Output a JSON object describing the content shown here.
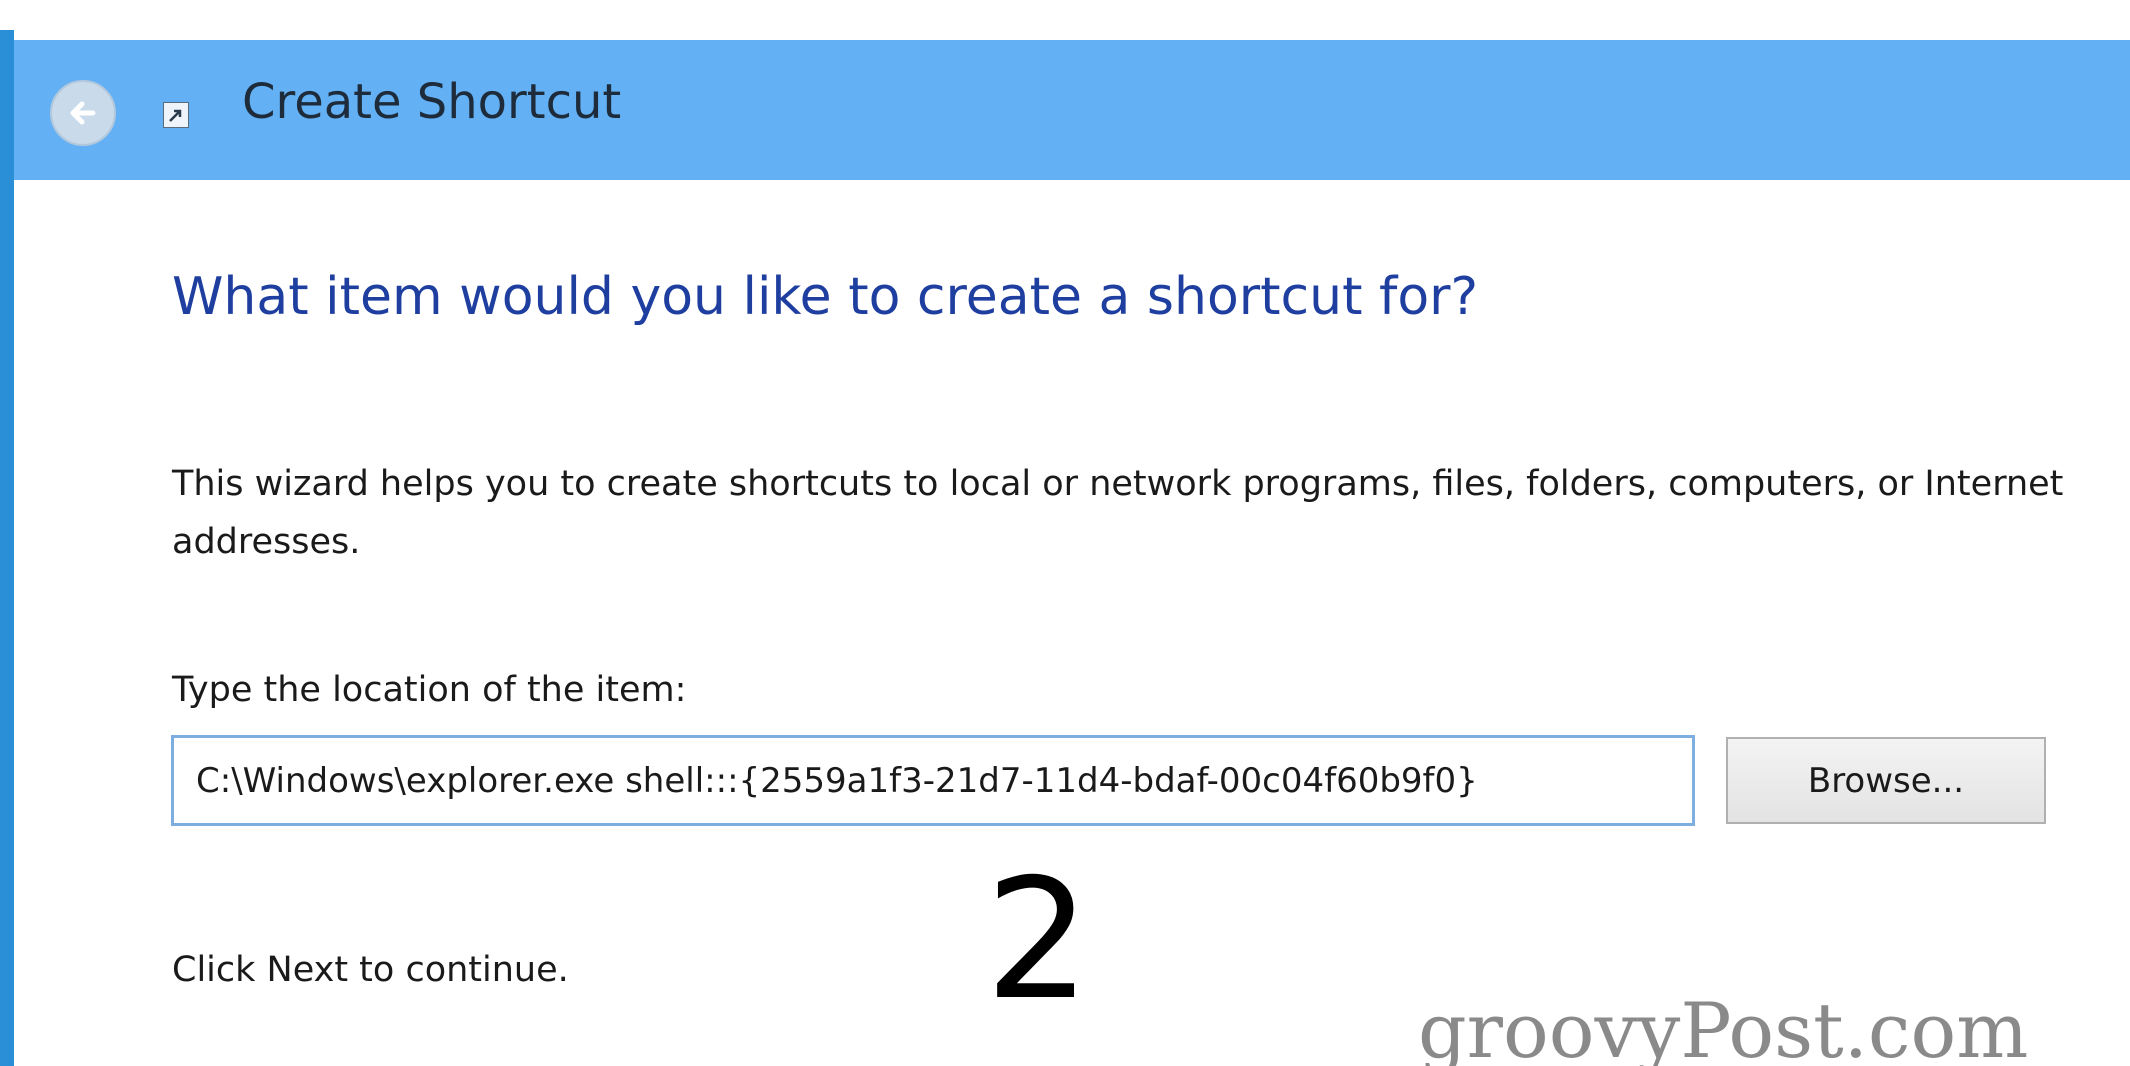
{
  "window": {
    "title": "Create Shortcut"
  },
  "wizard": {
    "heading": "What item would you like to create a shortcut for?",
    "description": "This wizard helps you to create shortcuts to local or network programs, files, folders, computers, or Internet addresses.",
    "location_label": "Type the location of the item:",
    "location_value": "C:\\Windows\\explorer.exe shell:::{2559a1f3-21d7-11d4-bdaf-00c04f60b9f0}",
    "browse_label": "Browse...",
    "continue_text": "Click Next to continue."
  },
  "annotation": {
    "step_number": "2"
  },
  "watermark": {
    "text": "groovyPost.com"
  },
  "colors": {
    "titlebar": "#63b1f4",
    "heading": "#1f3fa0",
    "input_border": "#7eaee0",
    "window_edge": "#2a8fd6"
  },
  "icons": {
    "back": "back-arrow-icon",
    "shortcut": "shortcut-icon"
  }
}
